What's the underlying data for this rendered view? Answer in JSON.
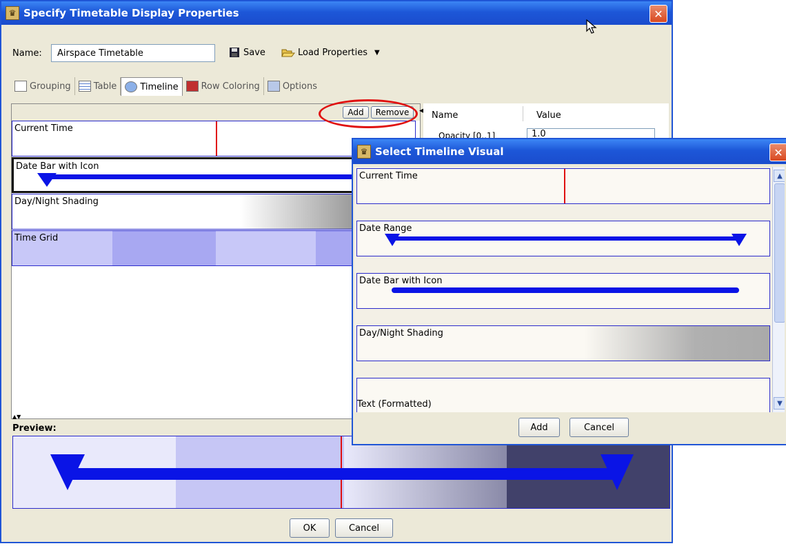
{
  "main_dialog": {
    "title": "Specify Timetable Display Properties",
    "name_label": "Name:",
    "name_value": "Airspace Timetable",
    "save_label": "Save",
    "load_label": "Load Properties",
    "tabs": [
      {
        "label": "Grouping"
      },
      {
        "label": "Table"
      },
      {
        "label": "Timeline"
      },
      {
        "label": "Row Coloring"
      },
      {
        "label": "Options"
      }
    ],
    "add_label": "Add",
    "remove_label": "Remove",
    "visual_rows": [
      "Current Time",
      "Date Bar with Icon",
      "Day/Night Shading",
      "Time Grid"
    ],
    "property_headers": {
      "name": "Name",
      "value": "Value"
    },
    "property_row": {
      "name": "Opacity [0..1]",
      "value": "1.0"
    },
    "preview_label": "Preview:",
    "ok_label": "OK",
    "cancel_label": "Cancel"
  },
  "select_dialog": {
    "title": "Select Timeline Visual",
    "items": [
      "Current Time",
      "Date Range",
      "Date Bar with Icon",
      "Day/Night Shading",
      "Text (Formatted)"
    ],
    "add_label": "Add",
    "cancel_label": "Cancel"
  },
  "colors": {
    "titlebar": "#1d57d8",
    "bar_blue": "#0a14e6",
    "highlight_red": "#e01010",
    "dialog_bg": "#ece9d8"
  }
}
